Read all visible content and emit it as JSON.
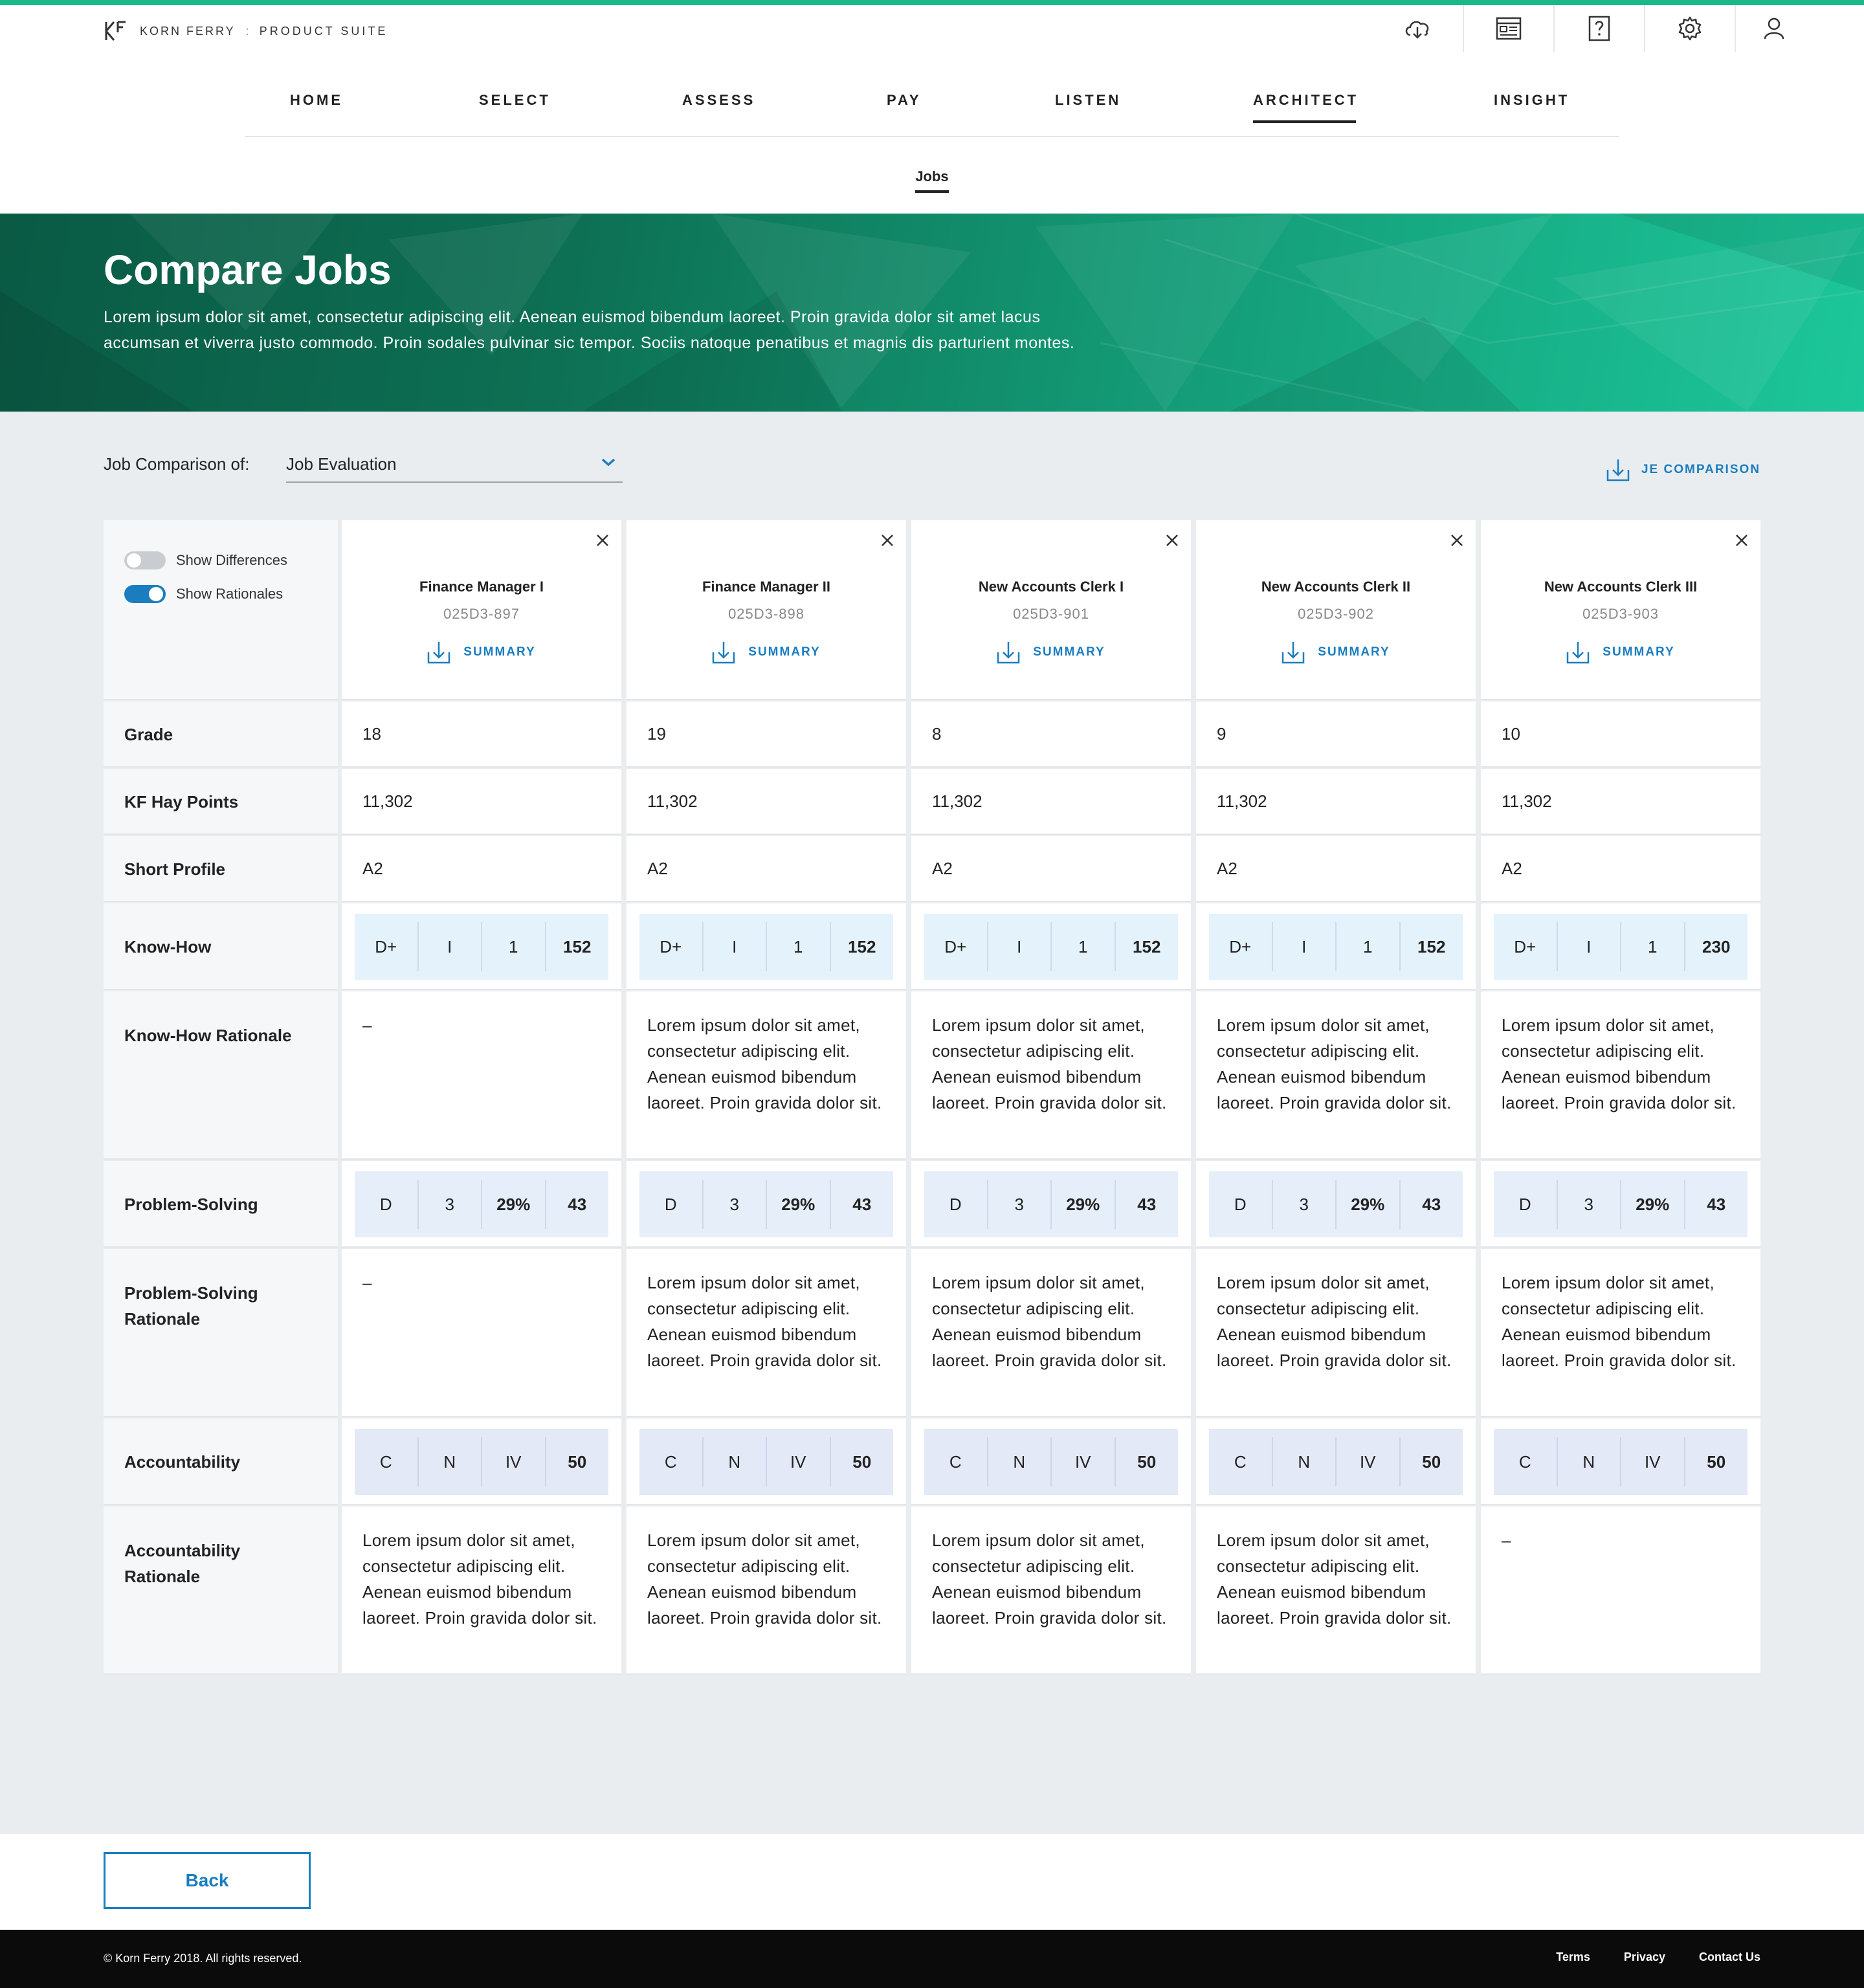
{
  "brand": {
    "name": "KORN FERRY",
    "separator": ":",
    "suite": "PRODUCT SUITE"
  },
  "top_icons": [
    "cloud-download-icon",
    "dashboard-icon",
    "help-icon",
    "gear-icon",
    "user-icon"
  ],
  "nav": {
    "items": [
      "HOME",
      "SELECT",
      "ASSESS",
      "PAY",
      "LISTEN",
      "ARCHITECT",
      "INSIGHT"
    ],
    "active": "ARCHITECT"
  },
  "subnav": {
    "item": "Jobs"
  },
  "hero": {
    "title": "Compare Jobs",
    "description": "Lorem ipsum dolor sit amet, consectetur adipiscing elit. Aenean euismod bibendum laoreet. Proin gravida dolor sit amet lacus accumsan et viverra justo commodo. Proin sodales pulvinar sic tempor. Sociis natoque penatibus et magnis dis parturient montes."
  },
  "filter": {
    "label": "Job Comparison of:",
    "value": "Job Evaluation"
  },
  "je_comparison": "JE COMPARISON",
  "toggles": {
    "differences": "Show Differences",
    "rationales": "Show Rationales",
    "differences_on": false,
    "rationales_on": true
  },
  "summary_label": "SUMMARY",
  "row_labels": {
    "grade": "Grade",
    "hay": "KF Hay Points",
    "profile": "Short Profile",
    "kh": "Know-How",
    "kh_rat": "Know-How Rationale",
    "ps": "Problem-Solving",
    "ps_rat_1": "Problem-Solving",
    "ps_rat_2": "Rationale",
    "ac": "Accountability",
    "ac_rat_1": "Accountability",
    "ac_rat_2": "Rationale"
  },
  "jobs": [
    {
      "title": "Finance Manager I",
      "code": "025D3-897",
      "grade": "18",
      "hay": "11,302",
      "profile": "A2",
      "kh": [
        "D+",
        "I",
        "1",
        "152"
      ],
      "kh_rat": "–",
      "ps": [
        "D",
        "3",
        "29%",
        "43"
      ],
      "ps_rat": "–",
      "ac": [
        "C",
        "N",
        "IV",
        "50"
      ],
      "ac_rat": "Lorem ipsum dolor sit amet, consectetur adipiscing elit. Aenean euismod bibendum laoreet. Proin gravida dolor sit."
    },
    {
      "title": "Finance Manager II",
      "code": "025D3-898",
      "grade": "19",
      "hay": "11,302",
      "profile": "A2",
      "kh": [
        "D+",
        "I",
        "1",
        "152"
      ],
      "kh_rat": "Lorem ipsum dolor sit amet, consectetur adipiscing elit. Aenean euismod bibendum laoreet. Proin gravida dolor sit.",
      "ps": [
        "D",
        "3",
        "29%",
        "43"
      ],
      "ps_rat": "Lorem ipsum dolor sit amet, consectetur adipiscing elit. Aenean euismod bibendum laoreet. Proin gravida dolor sit.",
      "ac": [
        "C",
        "N",
        "IV",
        "50"
      ],
      "ac_rat": "Lorem ipsum dolor sit amet, consectetur adipiscing elit. Aenean euismod bibendum laoreet. Proin gravida dolor sit."
    },
    {
      "title": "New Accounts Clerk I",
      "code": "025D3-901",
      "grade": "8",
      "hay": "11,302",
      "profile": "A2",
      "kh": [
        "D+",
        "I",
        "1",
        "152"
      ],
      "kh_rat": "Lorem ipsum dolor sit amet, consectetur adipiscing elit. Aenean euismod bibendum laoreet. Proin gravida dolor sit.",
      "ps": [
        "D",
        "3",
        "29%",
        "43"
      ],
      "ps_rat": "Lorem ipsum dolor sit amet, consectetur adipiscing elit. Aenean euismod bibendum laoreet. Proin gravida dolor sit.",
      "ac": [
        "C",
        "N",
        "IV",
        "50"
      ],
      "ac_rat": "Lorem ipsum dolor sit amet, consectetur adipiscing elit. Aenean euismod bibendum laoreet. Proin gravida dolor sit."
    },
    {
      "title": "New Accounts Clerk II",
      "code": "025D3-902",
      "grade": "9",
      "hay": "11,302",
      "profile": "A2",
      "kh": [
        "D+",
        "I",
        "1",
        "152"
      ],
      "kh_rat": "Lorem ipsum dolor sit amet, consectetur adipiscing elit. Aenean euismod bibendum laoreet. Proin gravida dolor sit.",
      "ps": [
        "D",
        "3",
        "29%",
        "43"
      ],
      "ps_rat": "Lorem ipsum dolor sit amet, consectetur adipiscing elit. Aenean euismod bibendum laoreet. Proin gravida dolor sit.",
      "ac": [
        "C",
        "N",
        "IV",
        "50"
      ],
      "ac_rat": "Lorem ipsum dolor sit amet, consectetur adipiscing elit. Aenean euismod bibendum laoreet. Proin gravida dolor sit."
    },
    {
      "title": "New Accounts Clerk III",
      "code": "025D3-903",
      "grade": "10",
      "hay": "11,302",
      "profile": "A2",
      "kh": [
        "D+",
        "I",
        "1",
        "230"
      ],
      "kh_rat": "Lorem ipsum dolor sit amet, consectetur adipiscing elit. Aenean euismod bibendum laoreet. Proin gravida dolor sit.",
      "ps": [
        "D",
        "3",
        "29%",
        "43"
      ],
      "ps_rat": "Lorem ipsum dolor sit amet, consectetur adipiscing elit. Aenean euismod bibendum laoreet. Proin gravida dolor sit.",
      "ac": [
        "C",
        "N",
        "IV",
        "50"
      ],
      "ac_rat": "–"
    }
  ],
  "back_label": "Back",
  "footer": {
    "copyright": "© Korn Ferry 2018. All rights reserved.",
    "links": [
      "Terms",
      "Privacy",
      "Contact Us"
    ]
  },
  "colors": {
    "accent": "#1a7dc0",
    "brand_green": "#1ab889",
    "hero_dark": "#0a5a44",
    "hero_light": "#1cc79a"
  }
}
